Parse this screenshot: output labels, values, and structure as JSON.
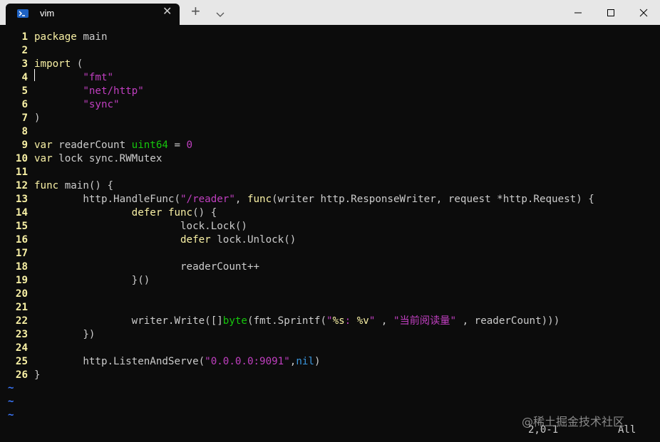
{
  "window": {
    "tab_title": "vim",
    "tab_close_glyph": "✕",
    "new_tab_glyph": "+",
    "icons": [
      "terminal-icon",
      "close-icon",
      "plus-icon",
      "chevron-down-icon",
      "minimize-icon",
      "maximize-icon",
      "window-close-icon"
    ]
  },
  "editor": {
    "lines": [
      {
        "n": "1",
        "parts": [
          {
            "t": "package",
            "c": "kw"
          },
          {
            "t": " main",
            "c": "pl"
          }
        ]
      },
      {
        "n": "2",
        "parts": []
      },
      {
        "n": "3",
        "parts": [
          {
            "t": "import",
            "c": "kw"
          },
          {
            "t": " (",
            "c": "pl"
          }
        ]
      },
      {
        "n": "4",
        "parts": [
          {
            "t": "        ",
            "c": "pl"
          },
          {
            "t": "\"fmt\"",
            "c": "st"
          }
        ]
      },
      {
        "n": "5",
        "parts": [
          {
            "t": "        ",
            "c": "pl"
          },
          {
            "t": "\"net/http\"",
            "c": "st"
          }
        ]
      },
      {
        "n": "6",
        "parts": [
          {
            "t": "        ",
            "c": "pl"
          },
          {
            "t": "\"sync\"",
            "c": "st"
          }
        ]
      },
      {
        "n": "7",
        "parts": [
          {
            "t": ")",
            "c": "pl"
          }
        ]
      },
      {
        "n": "8",
        "parts": []
      },
      {
        "n": "9",
        "parts": [
          {
            "t": "var",
            "c": "kw"
          },
          {
            "t": " readerCount ",
            "c": "pl"
          },
          {
            "t": "uint64",
            "c": "ty"
          },
          {
            "t": " = ",
            "c": "pl"
          },
          {
            "t": "0",
            "c": "nb"
          }
        ]
      },
      {
        "n": "10",
        "parts": [
          {
            "t": "var",
            "c": "kw"
          },
          {
            "t": " lock sync.RWMutex",
            "c": "pl"
          }
        ]
      },
      {
        "n": "11",
        "parts": []
      },
      {
        "n": "12",
        "parts": [
          {
            "t": "func",
            "c": "kw"
          },
          {
            "t": " main() {",
            "c": "pl"
          }
        ]
      },
      {
        "n": "13",
        "parts": [
          {
            "t": "        http.HandleFunc(",
            "c": "pl"
          },
          {
            "t": "\"/reader\"",
            "c": "st"
          },
          {
            "t": ", ",
            "c": "pl"
          },
          {
            "t": "func",
            "c": "kw"
          },
          {
            "t": "(writer http.ResponseWriter, request *http.Request) {",
            "c": "pl"
          }
        ]
      },
      {
        "n": "14",
        "parts": [
          {
            "t": "                ",
            "c": "pl"
          },
          {
            "t": "defer",
            "c": "kw"
          },
          {
            "t": " ",
            "c": "pl"
          },
          {
            "t": "func",
            "c": "kw"
          },
          {
            "t": "() {",
            "c": "pl"
          }
        ]
      },
      {
        "n": "15",
        "parts": [
          {
            "t": "                        lock.Lock()",
            "c": "pl"
          }
        ]
      },
      {
        "n": "16",
        "parts": [
          {
            "t": "                        ",
            "c": "pl"
          },
          {
            "t": "defer",
            "c": "kw"
          },
          {
            "t": " lock.Unlock()",
            "c": "pl"
          }
        ]
      },
      {
        "n": "17",
        "parts": []
      },
      {
        "n": "18",
        "parts": [
          {
            "t": "                        readerCount++",
            "c": "pl"
          }
        ]
      },
      {
        "n": "19",
        "parts": [
          {
            "t": "                }()",
            "c": "pl"
          }
        ]
      },
      {
        "n": "20",
        "parts": []
      },
      {
        "n": "21",
        "parts": []
      },
      {
        "n": "22",
        "parts": [
          {
            "t": "                writer.Write([]",
            "c": "pl"
          },
          {
            "t": "byte",
            "c": "ty"
          },
          {
            "t": "(fmt.Sprintf(",
            "c": "pl"
          },
          {
            "t": "\"",
            "c": "st"
          },
          {
            "t": "%s",
            "c": "kw"
          },
          {
            "t": ": ",
            "c": "st"
          },
          {
            "t": "%v",
            "c": "kw"
          },
          {
            "t": "\"",
            "c": "st"
          },
          {
            "t": " , ",
            "c": "pl"
          },
          {
            "t": "\"当前阅读量\"",
            "c": "st"
          },
          {
            "t": " , readerCount)))",
            "c": "pl"
          }
        ]
      },
      {
        "n": "23",
        "parts": [
          {
            "t": "        })",
            "c": "pl"
          }
        ]
      },
      {
        "n": "24",
        "parts": []
      },
      {
        "n": "25",
        "parts": [
          {
            "t": "        http.ListenAndServe(",
            "c": "pl"
          },
          {
            "t": "\"0.0.0.0:9091\"",
            "c": "st"
          },
          {
            "t": ",",
            "c": "pl"
          },
          {
            "t": "nil",
            "c": "cn"
          },
          {
            "t": ")",
            "c": "pl"
          }
        ]
      },
      {
        "n": "26",
        "parts": [
          {
            "t": "}",
            "c": "pl"
          }
        ]
      }
    ],
    "empty_line_markers": [
      "~",
      "~",
      "~"
    ]
  },
  "status": {
    "position": "2,0-1",
    "scroll": "All"
  },
  "watermark": "@稀土掘金技术社区"
}
